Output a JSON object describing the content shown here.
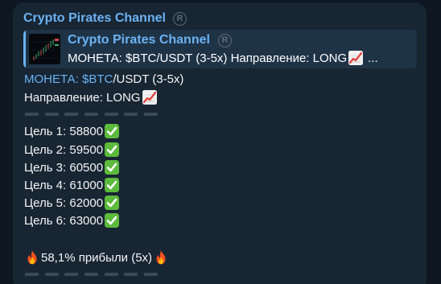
{
  "channel": {
    "name": "Crypto Pirates Channel",
    "badge_symbol": "R"
  },
  "reply": {
    "title": "Crypto Pirates Channel",
    "badge_symbol": "R",
    "preview_text": "МОНЕТА: $BTC/USDT (3-5x) Направление: LONG",
    "ellipsis": "...",
    "thumbnail_icon": "candlestick-chart-thumbnail"
  },
  "message": {
    "coin_label": "МОНЕТА:",
    "coin_ticker": "$BTC",
    "coin_rest": "/USDT (3-5x)",
    "direction_label": "Направление: LONG",
    "direction_icon": "chart-increasing-emoji",
    "targets": [
      {
        "label": "Цель 1: 58800",
        "icon": "check-mark-button-emoji"
      },
      {
        "label": "Цель 2: 59500",
        "icon": "check-mark-button-emoji"
      },
      {
        "label": "Цель 3: 60500",
        "icon": "check-mark-button-emoji"
      },
      {
        "label": "Цель 4: 61000",
        "icon": "check-mark-button-emoji"
      },
      {
        "label": "Цель 5: 62000",
        "icon": "check-mark-button-emoji"
      },
      {
        "label": "Цель 6: 63000",
        "icon": "check-mark-button-emoji"
      }
    ],
    "profit_text": "58,1% прибыли (5x)",
    "profit_icon": "fire-emoji"
  },
  "colors": {
    "background": "#0e1621",
    "bubble": "#182533",
    "link": "#6ab3f3",
    "reply_background": "#1f3347",
    "text": "#f5f5f5",
    "divider": "#3c4a57"
  }
}
